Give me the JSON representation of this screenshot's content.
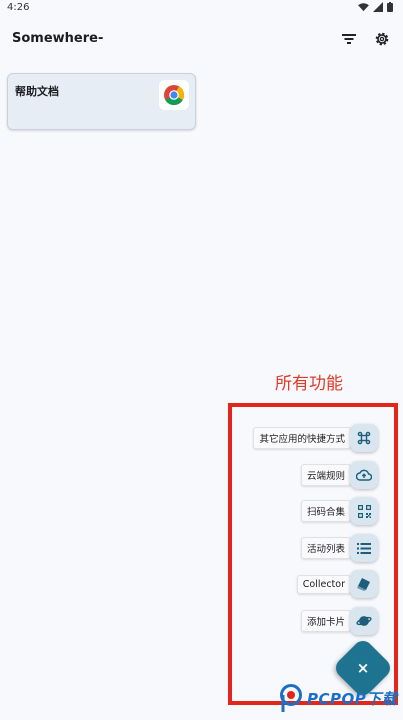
{
  "status": {
    "time": "4:26"
  },
  "appbar": {
    "title": "Somewhere-"
  },
  "cards": [
    {
      "label": "帮助文档"
    }
  ],
  "annotation": {
    "text": "所有功能"
  },
  "menu": [
    {
      "label": "其它应用的快捷方式",
      "icon": "command-icon"
    },
    {
      "label": "云端规则",
      "icon": "cloud-upload-icon"
    },
    {
      "label": "扫码合集",
      "icon": "qr-code-icon"
    },
    {
      "label": "活动列表",
      "icon": "list-icon"
    },
    {
      "label": "Collector",
      "icon": "eraser-icon"
    },
    {
      "label": "添加卡片",
      "icon": "planet-icon"
    }
  ],
  "fab": {
    "icon": "×"
  },
  "watermark": {
    "text": "PCPOP下载"
  },
  "colors": {
    "accent": "#1d7390",
    "annotation": "#e2261c",
    "card_bg": "#e7edf5",
    "mini_fab_bg": "#d9e6ef"
  }
}
